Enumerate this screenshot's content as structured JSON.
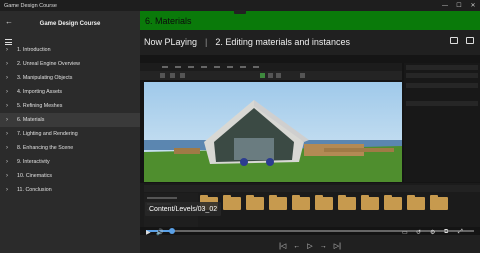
{
  "window": {
    "title": "Game Design Course",
    "controls": [
      "minimize-icon",
      "maximize-icon",
      "close-icon"
    ]
  },
  "sidebar": {
    "course_title": "Game Design Course",
    "chapters": [
      {
        "label": "1. Introduction",
        "selected": false
      },
      {
        "label": "2. Unreal Engine Overview",
        "selected": false
      },
      {
        "label": "3. Manipulating Objects",
        "selected": false
      },
      {
        "label": "4. Importing Assets",
        "selected": false
      },
      {
        "label": "5. Refining Meshes",
        "selected": false
      },
      {
        "label": "6. Materials",
        "selected": true
      },
      {
        "label": "7. Lighting and Rendering",
        "selected": false
      },
      {
        "label": "8. Enhancing the Scene",
        "selected": false
      },
      {
        "label": "9. Interactivity",
        "selected": false
      },
      {
        "label": "10. Cinematics",
        "selected": false
      },
      {
        "label": "11. Conclusion",
        "selected": false
      }
    ]
  },
  "banner": {
    "title": "6. Materials",
    "color": "#0a7a0a"
  },
  "now_playing": {
    "label": "Now PLaying",
    "lesson": "2. Editing materials and instances"
  },
  "video": {
    "caption": "Content/Levels/03_02",
    "progress_fraction": 0.08
  }
}
